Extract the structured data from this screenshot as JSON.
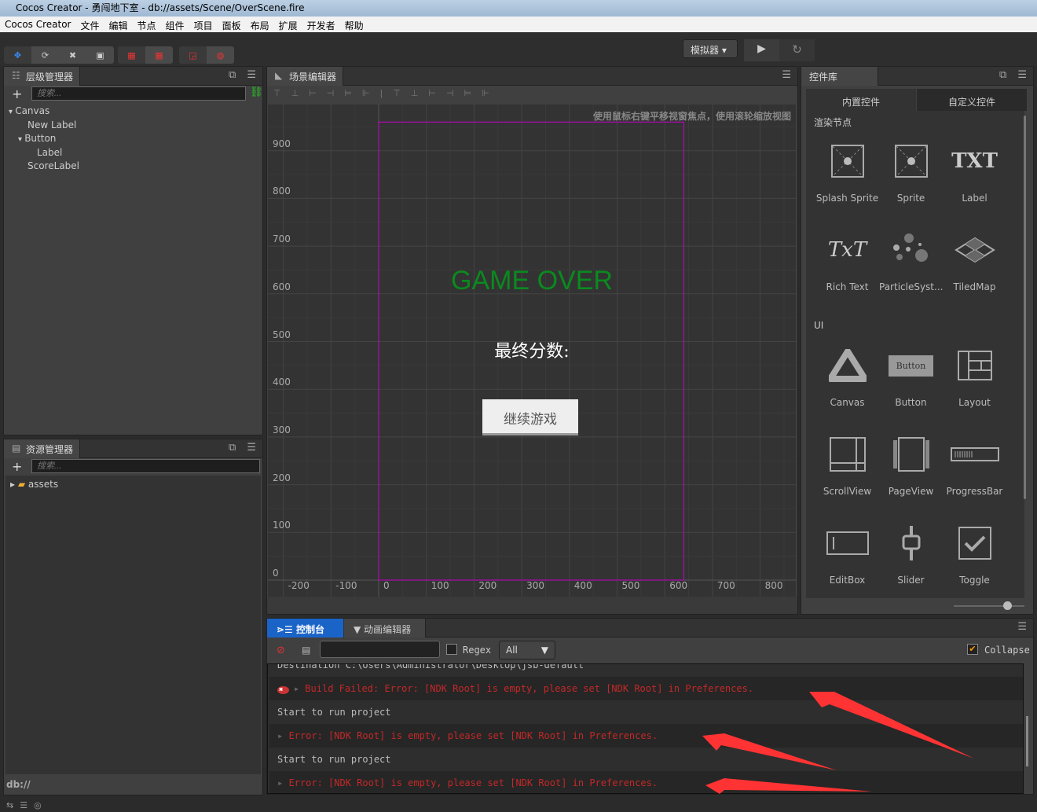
{
  "window": {
    "title": "Cocos Creator - 勇闯地下室 - db://assets/Scene/OverScene.fire"
  },
  "menu": [
    "Cocos Creator",
    "文件",
    "编辑",
    "节点",
    "组件",
    "项目",
    "面板",
    "布局",
    "扩展",
    "开发者",
    "帮助"
  ],
  "toolbar": {
    "platform": "模拟器",
    "play_icon": "play-icon",
    "refresh_icon": "refresh-icon"
  },
  "hierarchy": {
    "title": "层级管理器",
    "search_placeholder": "搜索...",
    "nodes": [
      {
        "label": "Canvas",
        "depth": 0,
        "expanded": true
      },
      {
        "label": "New Label",
        "depth": 1
      },
      {
        "label": "Button",
        "depth": 1,
        "expanded": true
      },
      {
        "label": "Label",
        "depth": 2
      },
      {
        "label": "ScoreLabel",
        "depth": 1
      }
    ]
  },
  "assets": {
    "title": "资源管理器",
    "search_placeholder": "搜索...",
    "items": [
      {
        "label": "assets"
      }
    ],
    "path": "db://"
  },
  "scene": {
    "title": "场景编辑器",
    "hint": "使用鼠标右键平移视窗焦点，使用滚轮缩放视图",
    "x_ticks": [
      "-200",
      "-100",
      "0",
      "100",
      "200",
      "300",
      "400",
      "500",
      "600",
      "700",
      "800"
    ],
    "y_ticks": [
      "900",
      "800",
      "700",
      "600",
      "500",
      "400",
      "300",
      "200",
      "100",
      "0"
    ],
    "game_over": "GAME OVER",
    "score_label": "最终分数:",
    "continue_button": "继续游戏",
    "game_over_color": "#0a8a1e",
    "frame_color": "#c800c8"
  },
  "library": {
    "title": "控件库",
    "tabs": [
      "内置控件",
      "自定义控件"
    ],
    "active_tab": 0,
    "sections": [
      {
        "title": "渲染节点",
        "items": [
          "Splash Sprite",
          "Sprite",
          "Label",
          "Rich Text",
          "ParticleSyst...",
          "TiledMap"
        ]
      },
      {
        "title": "UI",
        "items": [
          "Canvas",
          "Button",
          "Layout",
          "ScrollView",
          "PageView",
          "ProgressBar",
          "EditBox",
          "Slider",
          "Toggle"
        ]
      }
    ],
    "button_icon_text": "Button",
    "label_icon_text": "TXT",
    "richtext_icon_text": "TxT"
  },
  "console": {
    "tabs": [
      "控制台",
      "动画编辑器"
    ],
    "active_tab": 0,
    "filter_value": "",
    "regex_label": "Regex",
    "regex_checked": false,
    "level": "All",
    "collapse_label": "Collapse",
    "collapse_checked": true,
    "logs": [
      {
        "text": "Destination C:\\Users\\Administrator\\Desktop\\jsb-default",
        "type": "log"
      },
      {
        "text": "Build Failed: Error: [NDK Root] is empty, please set [NDK Root] in Preferences.",
        "type": "error"
      },
      {
        "text": "Start to run project",
        "type": "log"
      },
      {
        "text": "Error: [NDK Root] is empty, please set [NDK Root] in Preferences.",
        "type": "error"
      },
      {
        "text": "Start to run project",
        "type": "log"
      },
      {
        "text": "Error: [NDK Root] is empty, please set [NDK Root] in Preferences.",
        "type": "error"
      }
    ]
  }
}
